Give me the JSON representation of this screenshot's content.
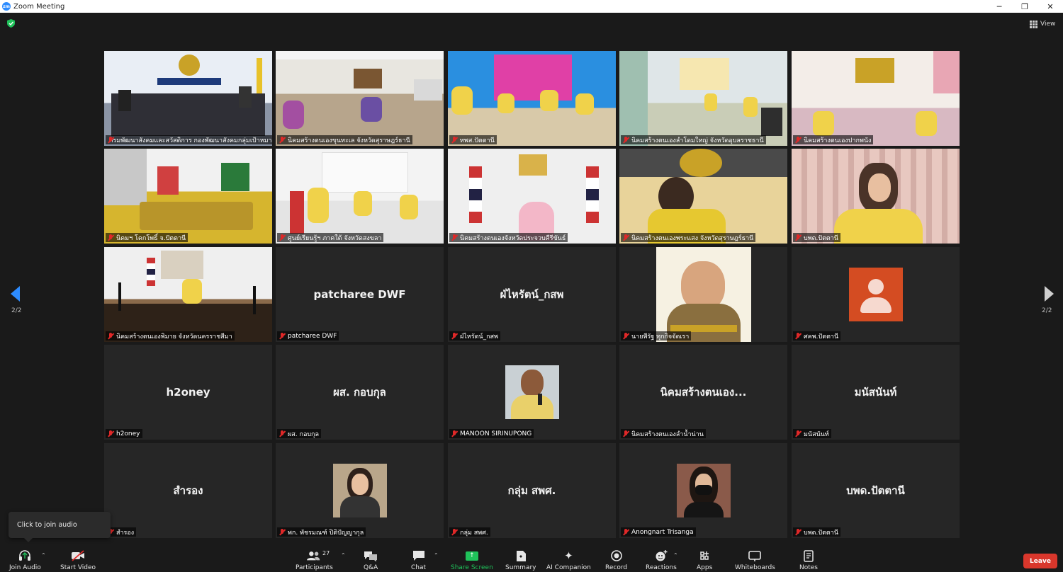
{
  "window": {
    "title": "Zoom Meeting",
    "controls": {
      "minimize": "─",
      "restore": "❐",
      "close": "✕"
    }
  },
  "view_button": {
    "label": "View"
  },
  "pagination": {
    "left_page": "2/2",
    "right_page": "2/2"
  },
  "tiles": [
    {
      "label": "กรมพัฒนาสังคมและสวัสดิการ กองพัฒนาสังคมกลุ่มเป้าหมาย...",
      "type": "video",
      "scene": "conference-room-blue"
    },
    {
      "label": "นิคมสร้างตนเองขุนทะเล จังหวัดสุราษฎร์ธานี",
      "type": "video",
      "scene": "office-room"
    },
    {
      "label": "ทพส.ปัตตานี",
      "type": "video",
      "scene": "pink-banner"
    },
    {
      "label": "นิคมสร้างตนเองลำโดมใหญ่ จังหวัดอุบลราชธานี",
      "type": "video",
      "scene": "hall-green"
    },
    {
      "label": "นิคมสร้างตนเองปากพนัง",
      "type": "video",
      "scene": "hall-pink"
    },
    {
      "label": "นิคมฯ โคกโพธิ์ จ.ปัตตานี",
      "type": "video",
      "scene": "gold-table",
      "active": true
    },
    {
      "label": "ศูนย์เรียนรู้ฯ ภาคใต้ จังหวัดสงขลา",
      "type": "video",
      "scene": "meeting-white"
    },
    {
      "label": "นิคมสร้างตนเองจังหวัดประจวบคีรีขันธ์",
      "type": "video",
      "scene": "speaker-flags"
    },
    {
      "label": "นิคมสร้างตนเองพระแสง จังหวัดสุราษฎร์ธานี",
      "type": "video",
      "scene": "close-man"
    },
    {
      "label": "บพด.ปัตตานี",
      "type": "video",
      "scene": "woman-curtain"
    },
    {
      "label": "นิคมสร้างตนเองพิมาย จังหวัดนครราชสีมา",
      "type": "video",
      "scene": "mic-room"
    },
    {
      "label": "patcharee DWF",
      "type": "name",
      "big": "patcharee DWF"
    },
    {
      "label": "ฝ่ไหรัตน์_กสพ",
      "type": "name",
      "big": "ฝ่ไหรัตน์_กสพ"
    },
    {
      "label": "นายพีรัฐ ทุกกิจจัดเรา",
      "type": "avatar",
      "avatar": "man-poster"
    },
    {
      "label": "ศคพ.ปัตตานี",
      "type": "avatar",
      "avatar": "default-user"
    },
    {
      "label": "h2oney",
      "type": "name",
      "big": "h2oney"
    },
    {
      "label": "ผส. กอบกุล",
      "type": "name",
      "big": "ผส. กอบกุล"
    },
    {
      "label": "MANOON SIRINUPONG",
      "type": "avatar",
      "avatar": "man-mic"
    },
    {
      "label": "นิคมสร้างตนเองลำน้ำน่าน",
      "type": "name",
      "big": "นิคมสร้างตนเอง..."
    },
    {
      "label": "มนัสนันท์",
      "type": "name",
      "big": "มนัสนันท์"
    },
    {
      "label": "สำรอง",
      "type": "name",
      "big": "สำรอง"
    },
    {
      "label": "พก. พัชรมณฑ์ ปิติปัญญากุล",
      "type": "avatar",
      "avatar": "woman-desk"
    },
    {
      "label": "กลุ่ม สพศ.",
      "type": "name",
      "big": "กลุ่ม สพศ."
    },
    {
      "label": "Anongnart Trisanga",
      "type": "avatar",
      "avatar": "woman-mask"
    },
    {
      "label": "บพด.ปัตตานี",
      "type": "name",
      "big": "บพด.ปัตตานี"
    }
  ],
  "tooltip": {
    "text": "Click to join audio"
  },
  "toolbar": {
    "join_audio": "Join Audio",
    "start_video": "Start Video",
    "participants": "Participants",
    "participants_count": "27",
    "qa": "Q&A",
    "chat": "Chat",
    "share_screen": "Share Screen",
    "summary": "Summary",
    "ai_companion": "AI Companion",
    "record": "Record",
    "reactions": "Reactions",
    "apps": "Apps",
    "whiteboards": "Whiteboards",
    "notes": "Notes",
    "leave": "Leave"
  },
  "colors": {
    "accent": "#2d8cff",
    "leave": "#d9372c",
    "share": "#1fc25a",
    "active_speaker": "#d6e44a",
    "muted": "#e02828"
  }
}
